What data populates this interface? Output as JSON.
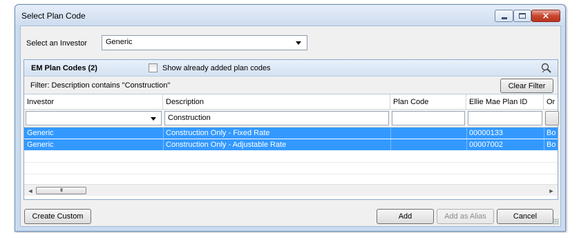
{
  "window": {
    "title": "Select Plan Code",
    "controls": {
      "minimize": "minimize",
      "maximize": "maximize",
      "close": "×"
    }
  },
  "investor": {
    "label": "Select an Investor",
    "selected": "Generic"
  },
  "panel": {
    "title": "EM Plan Codes (2)",
    "show_added_label": "Show already added plan codes",
    "show_added_checked": false,
    "filter_text": "Filter: Description contains \"Construction\"",
    "clear_filter_label": "Clear Filter"
  },
  "table": {
    "columns": [
      "Investor",
      "Description",
      "Plan Code",
      "Ellie Mae Plan ID",
      "Or"
    ],
    "filters": {
      "investor": "",
      "description": "Construction",
      "plan_code": "",
      "plan_id": ""
    },
    "rows": [
      {
        "investor": "Generic",
        "description": "Construction Only - Fixed Rate",
        "plan_code": "",
        "plan_id": "00000133",
        "extra": "Bo",
        "selected": true
      },
      {
        "investor": "Generic",
        "description": "Construction Only - Adjustable Rate",
        "plan_code": "",
        "plan_id": "00007002",
        "extra": "Bo",
        "selected": true
      }
    ],
    "scroll": {
      "left_arrow": "◄",
      "thumb_grip": "III",
      "right_arrow": "►"
    }
  },
  "buttons": {
    "create_custom": "Create Custom",
    "add": "Add",
    "add_as_alias": "Add as Alias",
    "cancel": "Cancel"
  },
  "colors": {
    "selection": "#3399ff",
    "title_bar": "#cddcef",
    "close_button": "#c8452f"
  }
}
